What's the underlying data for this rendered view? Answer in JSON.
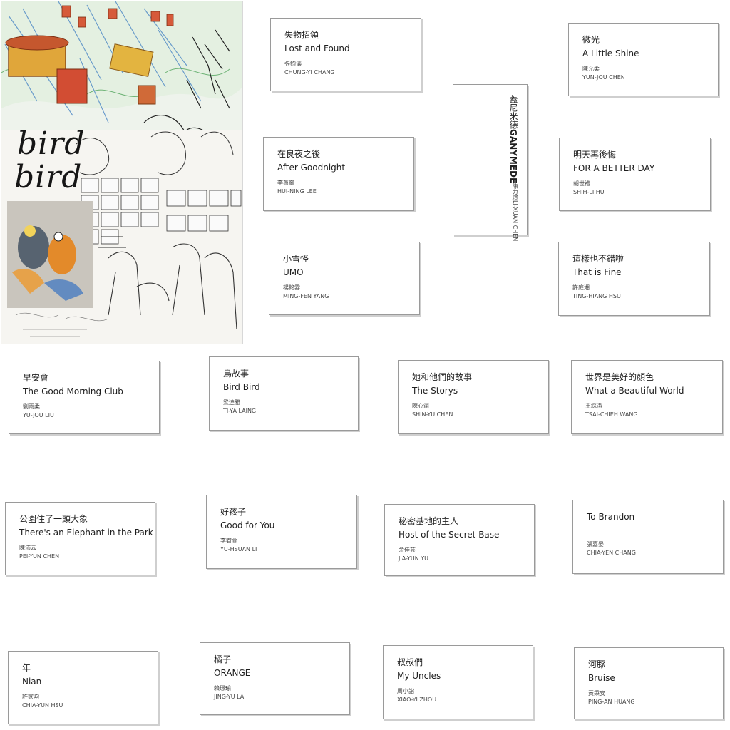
{
  "poster": {
    "title_line1": "bird",
    "title_line2": "bird"
  },
  "cards": [
    {
      "zh": "失物招領",
      "en": "Lost and Found",
      "author_zh": "張鈞儀",
      "author_en": "CHUNG-YI CHANG"
    },
    {
      "zh": "微光",
      "en": "A Little Shine",
      "author_zh": "陳允柔",
      "author_en": "YUN-JOU CHEN"
    },
    {
      "zh": "蓋尼米德",
      "en": "GANYMEDE",
      "author_zh": "陳力瑄",
      "author_en": "LI-XUAN CHEN"
    },
    {
      "zh": "在良夜之後",
      "en": "After Goodnight",
      "author_zh": "李蕙寧",
      "author_en": "HUI-NING LEE"
    },
    {
      "zh": "明天再後悔",
      "en": "FOR A BETTER DAY",
      "author_zh": "胡世禮",
      "author_en": "SHIH-LI HU"
    },
    {
      "zh": "小雪怪",
      "en": "UMO",
      "author_zh": "楊銘雰",
      "author_en": "MING-FEN YANG"
    },
    {
      "zh": "這樣也不錯啦",
      "en": "That is Fine",
      "author_zh": "許庭湘",
      "author_en": "TING-HIANG HSU"
    },
    {
      "zh": "早安會",
      "en": "The Good Morning Club",
      "author_zh": "劉雨柔",
      "author_en": "YU-JOU LIU"
    },
    {
      "zh": "鳥故事",
      "en": "Bird Bird",
      "author_zh": "梁迪雅",
      "author_en": "TI-YA LAING"
    },
    {
      "zh": "她和他們的故事",
      "en": "The Storys",
      "author_zh": "陳心渝",
      "author_en": "SHIN-YU CHEN"
    },
    {
      "zh": "世界是美好的顏色",
      "en": "What a Beautiful World",
      "author_zh": "王綵潔",
      "author_en": "TSAI-CHIEH WANG"
    },
    {
      "zh": "公園住了一頭大象",
      "en": "There's an Elephant in the Park",
      "author_zh": "陳沛云",
      "author_en": "PEI-YUN CHEN"
    },
    {
      "zh": "好孩子",
      "en": "Good for You",
      "author_zh": "李宥萱",
      "author_en": "YU-HSUAN LI"
    },
    {
      "zh": "秘密基地的主人",
      "en": "Host of the Secret Base",
      "author_zh": "余佳芸",
      "author_en": "JIA-YUN YU"
    },
    {
      "zh": "",
      "en": "To Brandon",
      "author_zh": "張嘉晏",
      "author_en": "CHIA-YEN CHANG"
    },
    {
      "zh": "年",
      "en": "Nian",
      "author_zh": "許家昀",
      "author_en": "CHIA-YUN HSU"
    },
    {
      "zh": "橘子",
      "en": "ORANGE",
      "author_zh": "賴璟瑜",
      "author_en": "JING-YU LAI"
    },
    {
      "zh": "叔叔們",
      "en": "My Uncles",
      "author_zh": "周小詣",
      "author_en": "XIAO-YI ZHOU"
    },
    {
      "zh": "河豚",
      "en": "Bruise",
      "author_zh": "黃秉安",
      "author_en": "PING-AN HUANG"
    }
  ]
}
